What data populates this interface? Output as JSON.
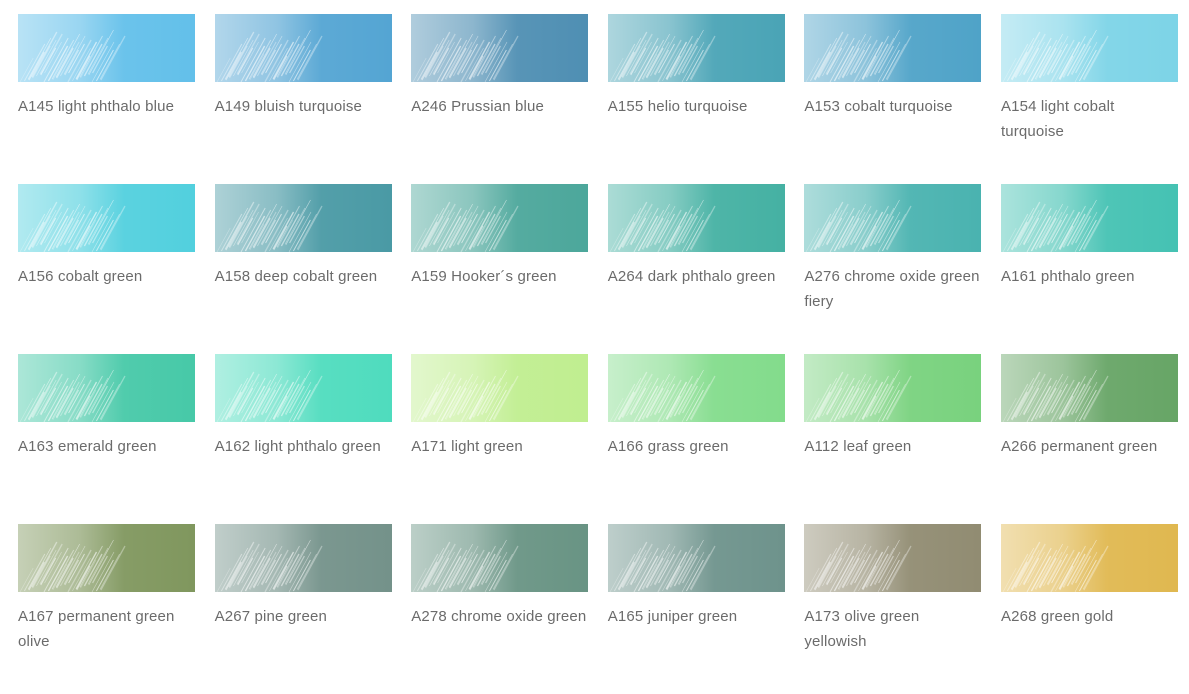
{
  "swatches": [
    {
      "label": "A145 light phthalo blue",
      "color": "#63c0ea"
    },
    {
      "label": "A149 bluish turquoise",
      "color": "#54a5d3"
    },
    {
      "label": "A246 Prussian blue",
      "color": "#4f8fb3"
    },
    {
      "label": "A155 helio turquoise",
      "color": "#4aa4b6"
    },
    {
      "label": "A153 cobalt turquoise",
      "color": "#4fa3c8"
    },
    {
      "label": "A154 light cobalt turquoise",
      "color": "#7dd4e7"
    },
    {
      "label": "A156 cobalt green",
      "color": "#52d0de"
    },
    {
      "label": "A158 deep cobalt green",
      "color": "#4a9aa5"
    },
    {
      "label": "A159 Hooker´s green",
      "color": "#4ca79b"
    },
    {
      "label": "A264 dark phthalo green",
      "color": "#45b1a3"
    },
    {
      "label": "A276 chrome oxide green fiery",
      "color": "#4ab3b0"
    },
    {
      "label": "A161 phthalo green",
      "color": "#45c2b3"
    },
    {
      "label": "A163 emerald green",
      "color": "#47c9a8"
    },
    {
      "label": "A162 light phthalo green",
      "color": "#4fdcbe"
    },
    {
      "label": "A171 light green",
      "color": "#c0ee90"
    },
    {
      "label": "A166 grass green",
      "color": "#83dc8c"
    },
    {
      "label": "A112 leaf green",
      "color": "#79d27e"
    },
    {
      "label": "A266 permanent green",
      "color": "#67a566"
    },
    {
      "label": "A167 permanent green olive",
      "color": "#80975e"
    },
    {
      "label": "A267 pine green",
      "color": "#74928a"
    },
    {
      "label": "A278 chrome oxide green",
      "color": "#699484"
    },
    {
      "label": "A165 juniper green",
      "color": "#6e938c"
    },
    {
      "label": "A173 olive green yellowish",
      "color": "#918c72"
    },
    {
      "label": "A268 green gold",
      "color": "#e0b850"
    }
  ]
}
